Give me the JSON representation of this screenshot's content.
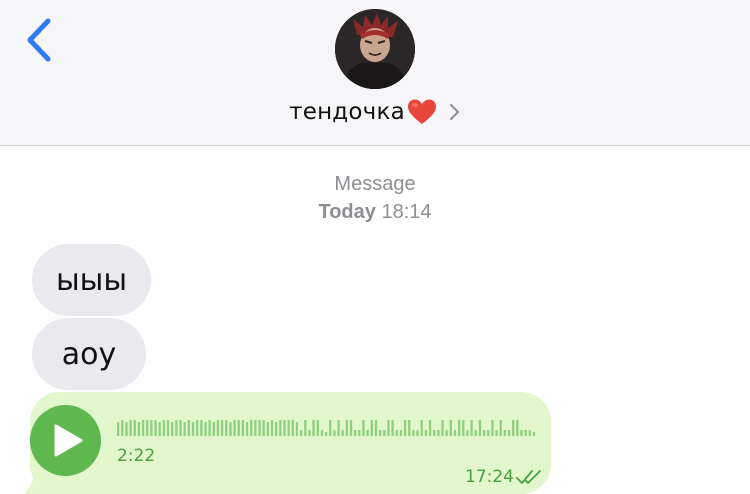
{
  "header": {
    "contact_name": "тендочка",
    "contact_emoji": "heart-emoji"
  },
  "meta": {
    "service": "Message",
    "day": "Today",
    "time": "18:14"
  },
  "messages": [
    {
      "text": "ыыы"
    },
    {
      "text": "аоу"
    }
  ],
  "voice_message": {
    "duration": "2:22",
    "sent_time": "17:24",
    "status": "read"
  },
  "colors": {
    "accent_blue": "#2f7cf6",
    "incoming_bubble": "#e9e9ee",
    "voice_bubble": "#e2f7cc",
    "voice_green": "#5fb84e"
  }
}
